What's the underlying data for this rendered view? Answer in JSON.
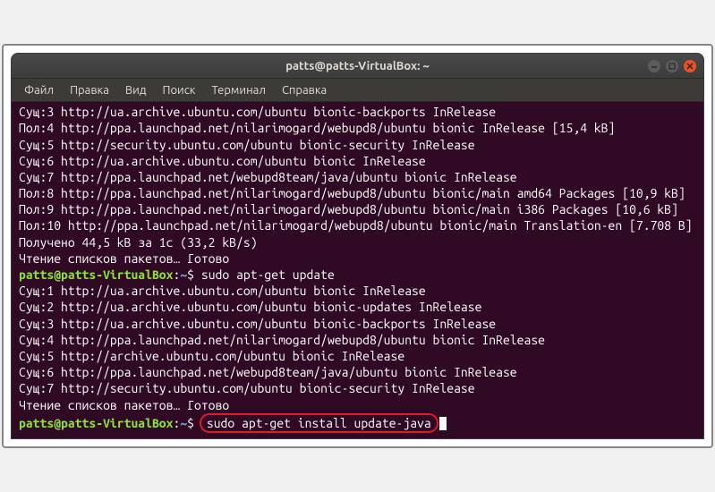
{
  "titlebar": {
    "title": "patts@patts-VirtualBox: ~"
  },
  "menubar": {
    "items": [
      {
        "label": "Файл"
      },
      {
        "label": "Правка"
      },
      {
        "label": "Вид"
      },
      {
        "label": "Поиск"
      },
      {
        "label": "Терминал"
      },
      {
        "label": "Справка"
      }
    ]
  },
  "terminal": {
    "output_lines": [
      "Сущ:3 http://ua.archive.ubuntu.com/ubuntu bionic-backports InRelease",
      "Пол:4 http://ppa.launchpad.net/nilarimogard/webupd8/ubuntu bionic InRelease [15,4 kB]",
      "Сущ:5 http://security.ubuntu.com/ubuntu bionic-security InRelease",
      "Сущ:6 http://ua.archive.ubuntu.com/ubuntu bionic InRelease",
      "Сущ:7 http://ppa.launchpad.net/webupd8team/java/ubuntu bionic InRelease",
      "Пол:8 http://ppa.launchpad.net/nilarimogard/webupd8/ubuntu bionic/main amd64 Packages [10,9 kB]",
      "Пол:9 http://ppa.launchpad.net/nilarimogard/webupd8/ubuntu bionic/main i386 Packages [10,6 kB]",
      "Пол:10 http://ppa.launchpad.net/nilarimogard/webupd8/ubuntu bionic/main Translation-en [7.708 B]",
      "Получено 44,5 kB за 1с (33,2 kB/s)",
      "Чтение списков пакетов… Готово"
    ],
    "prompt1": {
      "user_host": "patts@patts-VirtualBox",
      "path": "~",
      "command": "sudo apt-get update"
    },
    "output_lines2": [
      "Сущ:1 http://ua.archive.ubuntu.com/ubuntu bionic InRelease",
      "Сущ:2 http://ua.archive.ubuntu.com/ubuntu bionic-updates InRelease",
      "Сущ:3 http://ua.archive.ubuntu.com/ubuntu bionic-backports InRelease",
      "Сущ:4 http://ppa.launchpad.net/nilarimogard/webupd8/ubuntu bionic InRelease",
      "Сущ:5 http://archive.ubuntu.com/ubuntu bionic InRelease",
      "Сущ:6 http://ppa.launchpad.net/webupd8team/java/ubuntu bionic InRelease",
      "Сущ:7 http://security.ubuntu.com/ubuntu bionic-security InRelease",
      "Чтение списков пакетов… Готово"
    ],
    "prompt2": {
      "user_host": "patts@patts-VirtualBox",
      "path": "~",
      "command": "sudo apt-get install update-java"
    }
  },
  "highlight_color": "#e01b24"
}
